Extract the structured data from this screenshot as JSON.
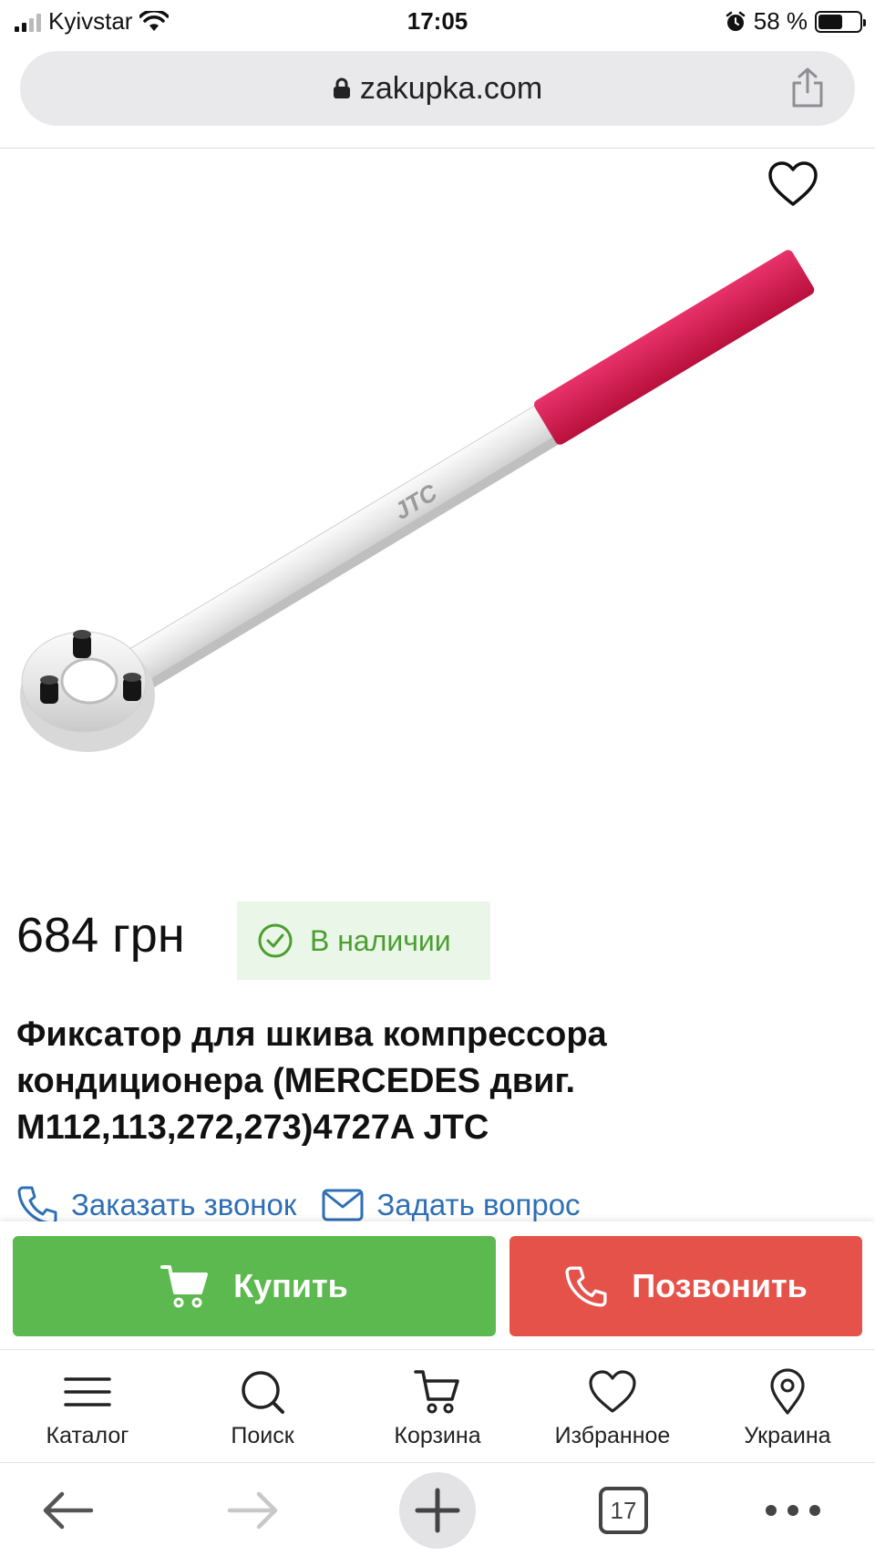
{
  "status_bar": {
    "carrier": "Kyivstar",
    "time": "17:05",
    "battery": "58 %",
    "battery_level": 0.58
  },
  "browser": {
    "url": "zakupka.com",
    "tab_count": "17"
  },
  "product": {
    "price": "684 грн",
    "availability": "В наличии",
    "title": "Фиксатор для шкива компрессора кондиционера (MERCEDES двиг. M112,113,272,273)4727A JTC",
    "image_brand_text": "JTC"
  },
  "links": {
    "order_call": "Заказать звонок",
    "ask_question": "Задать вопрос"
  },
  "actions": {
    "buy": "Купить",
    "call": "Позвонить"
  },
  "bottom_nav": {
    "items": [
      {
        "label": "Каталог",
        "icon": "menu-icon"
      },
      {
        "label": "Поиск",
        "icon": "search-icon"
      },
      {
        "label": "Корзина",
        "icon": "cart-icon"
      },
      {
        "label": "Избранное",
        "icon": "heart-icon"
      },
      {
        "label": "Украина",
        "icon": "location-pin-icon"
      }
    ]
  },
  "colors": {
    "buy_green": "#5cb94f",
    "call_red": "#e5524a",
    "link_blue": "#2f6fb5",
    "stock_green": "#4b9e30",
    "handle_red": "#d6194a"
  }
}
